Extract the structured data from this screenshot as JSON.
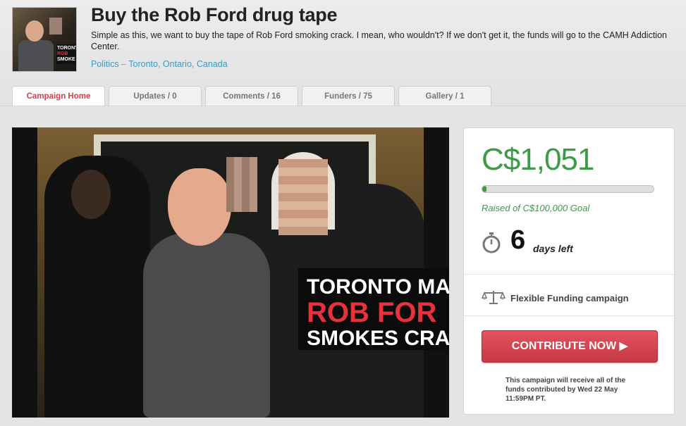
{
  "campaign": {
    "title": "Buy the Rob Ford drug tape",
    "description": "Simple as this, we want to buy the tape of Rob Ford smoking crack. I mean, who wouldn't? If we don't get it, the funds will go to the CAMH Addiction Center.",
    "category": "Politics",
    "separator": "–",
    "location": "Toronto, Ontario, Canada",
    "thumbnail_text": [
      "TORONTO",
      "ROB",
      "SMOKE"
    ]
  },
  "tabs": [
    {
      "label": "Campaign Home",
      "active": true
    },
    {
      "label": "Updates / 0",
      "active": false
    },
    {
      "label": "Comments / 16",
      "active": false
    },
    {
      "label": "Funders / 75",
      "active": false
    },
    {
      "label": "Gallery / 1",
      "active": false
    }
  ],
  "media": {
    "caption_line1": "TORONTO MAY",
    "caption_line2": "ROB FOR",
    "caption_line3": "SMOKES CRA"
  },
  "funding": {
    "raised": "C$1,051",
    "goal_text": "Raised of C$100,000 Goal",
    "progress_fraction": 0.0105,
    "days_left_number": "6",
    "days_left_label": "days left",
    "funding_type": "Flexible Funding campaign",
    "cta_label": "CONTRIBUTE NOW",
    "cta_icon": "play-arrow-icon",
    "note": "This campaign will receive all of the funds contributed by Wed 22 May 11:59PM PT."
  },
  "colors": {
    "accent_green": "#3d9a47",
    "cta_red": "#d2404b",
    "link_blue": "#3a9ac4"
  }
}
